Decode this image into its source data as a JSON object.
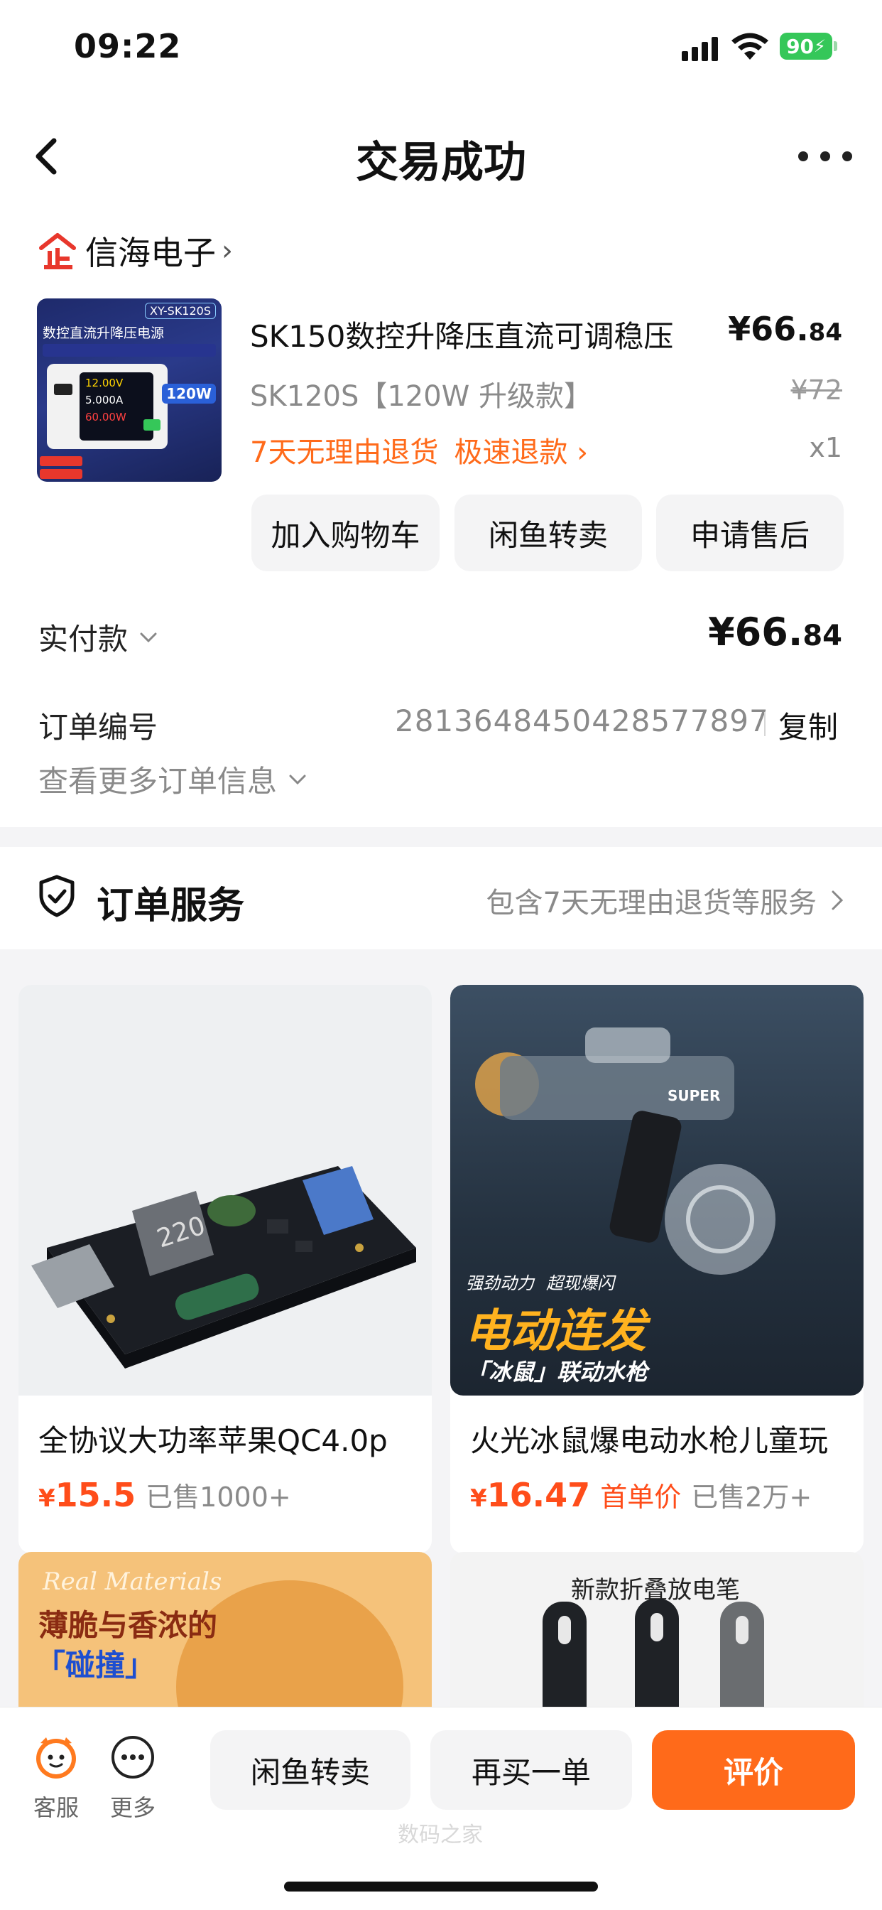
{
  "status_bar": {
    "time": "09:22",
    "battery": "90"
  },
  "nav": {
    "title": "交易成功"
  },
  "shop": {
    "name": "信海电子"
  },
  "product": {
    "title": "SK150数控升降压直流可调稳压",
    "price_main": "¥66.",
    "price_cents": "84",
    "sku": "SK120S【120W 升级款】",
    "original_price": "¥72",
    "tag_return": "7天无理由退货",
    "tag_refund": "极速退款 ›",
    "quantity": "x1",
    "thumb_label": "XY-SK120S",
    "thumb_title": "数控直流升降压电源",
    "thumb_watt": "120W",
    "thumb_readings": [
      "12.00V",
      "5.000A",
      "60.00W"
    ]
  },
  "actions": {
    "add_cart": "加入购物车",
    "resell": "闲鱼转卖",
    "after_sale": "申请售后"
  },
  "payment": {
    "label": "实付款",
    "amount_main": "¥66.",
    "amount_cents": "84"
  },
  "order": {
    "number_label": "订单编号",
    "number": "2813648450428577897",
    "copy": "复制",
    "more_info": "查看更多订单信息"
  },
  "service": {
    "title": "订单服务",
    "desc": "包含7天无理由退货等服务"
  },
  "feed": [
    {
      "title": "全协议大功率苹果QC4.0p",
      "currency": "¥",
      "price": "15.5",
      "first_order": "",
      "sold": "已售1000+"
    },
    {
      "title": "火光冰鼠爆电动水枪儿童玩",
      "currency": "¥",
      "price": "16.47",
      "first_order": "首单价",
      "sold": "已售2万+",
      "img_text_1": "强劲动力",
      "img_text_2": "超现爆闪",
      "img_headline": "电动连发",
      "img_sub": "「冰鼠」联动水枪",
      "img_brand": "SUPER"
    },
    {
      "img_text_en": "Real Materials",
      "img_text_1": "薄脆与香浓的",
      "img_text_2": "「碰撞」"
    },
    {
      "img_text_1": "新款折叠放电笔"
    }
  ],
  "bottom_bar": {
    "service": "客服",
    "more": "更多",
    "resell": "闲鱼转卖",
    "rebuy": "再买一单",
    "review": "评价"
  },
  "watermark": "数码之家"
}
